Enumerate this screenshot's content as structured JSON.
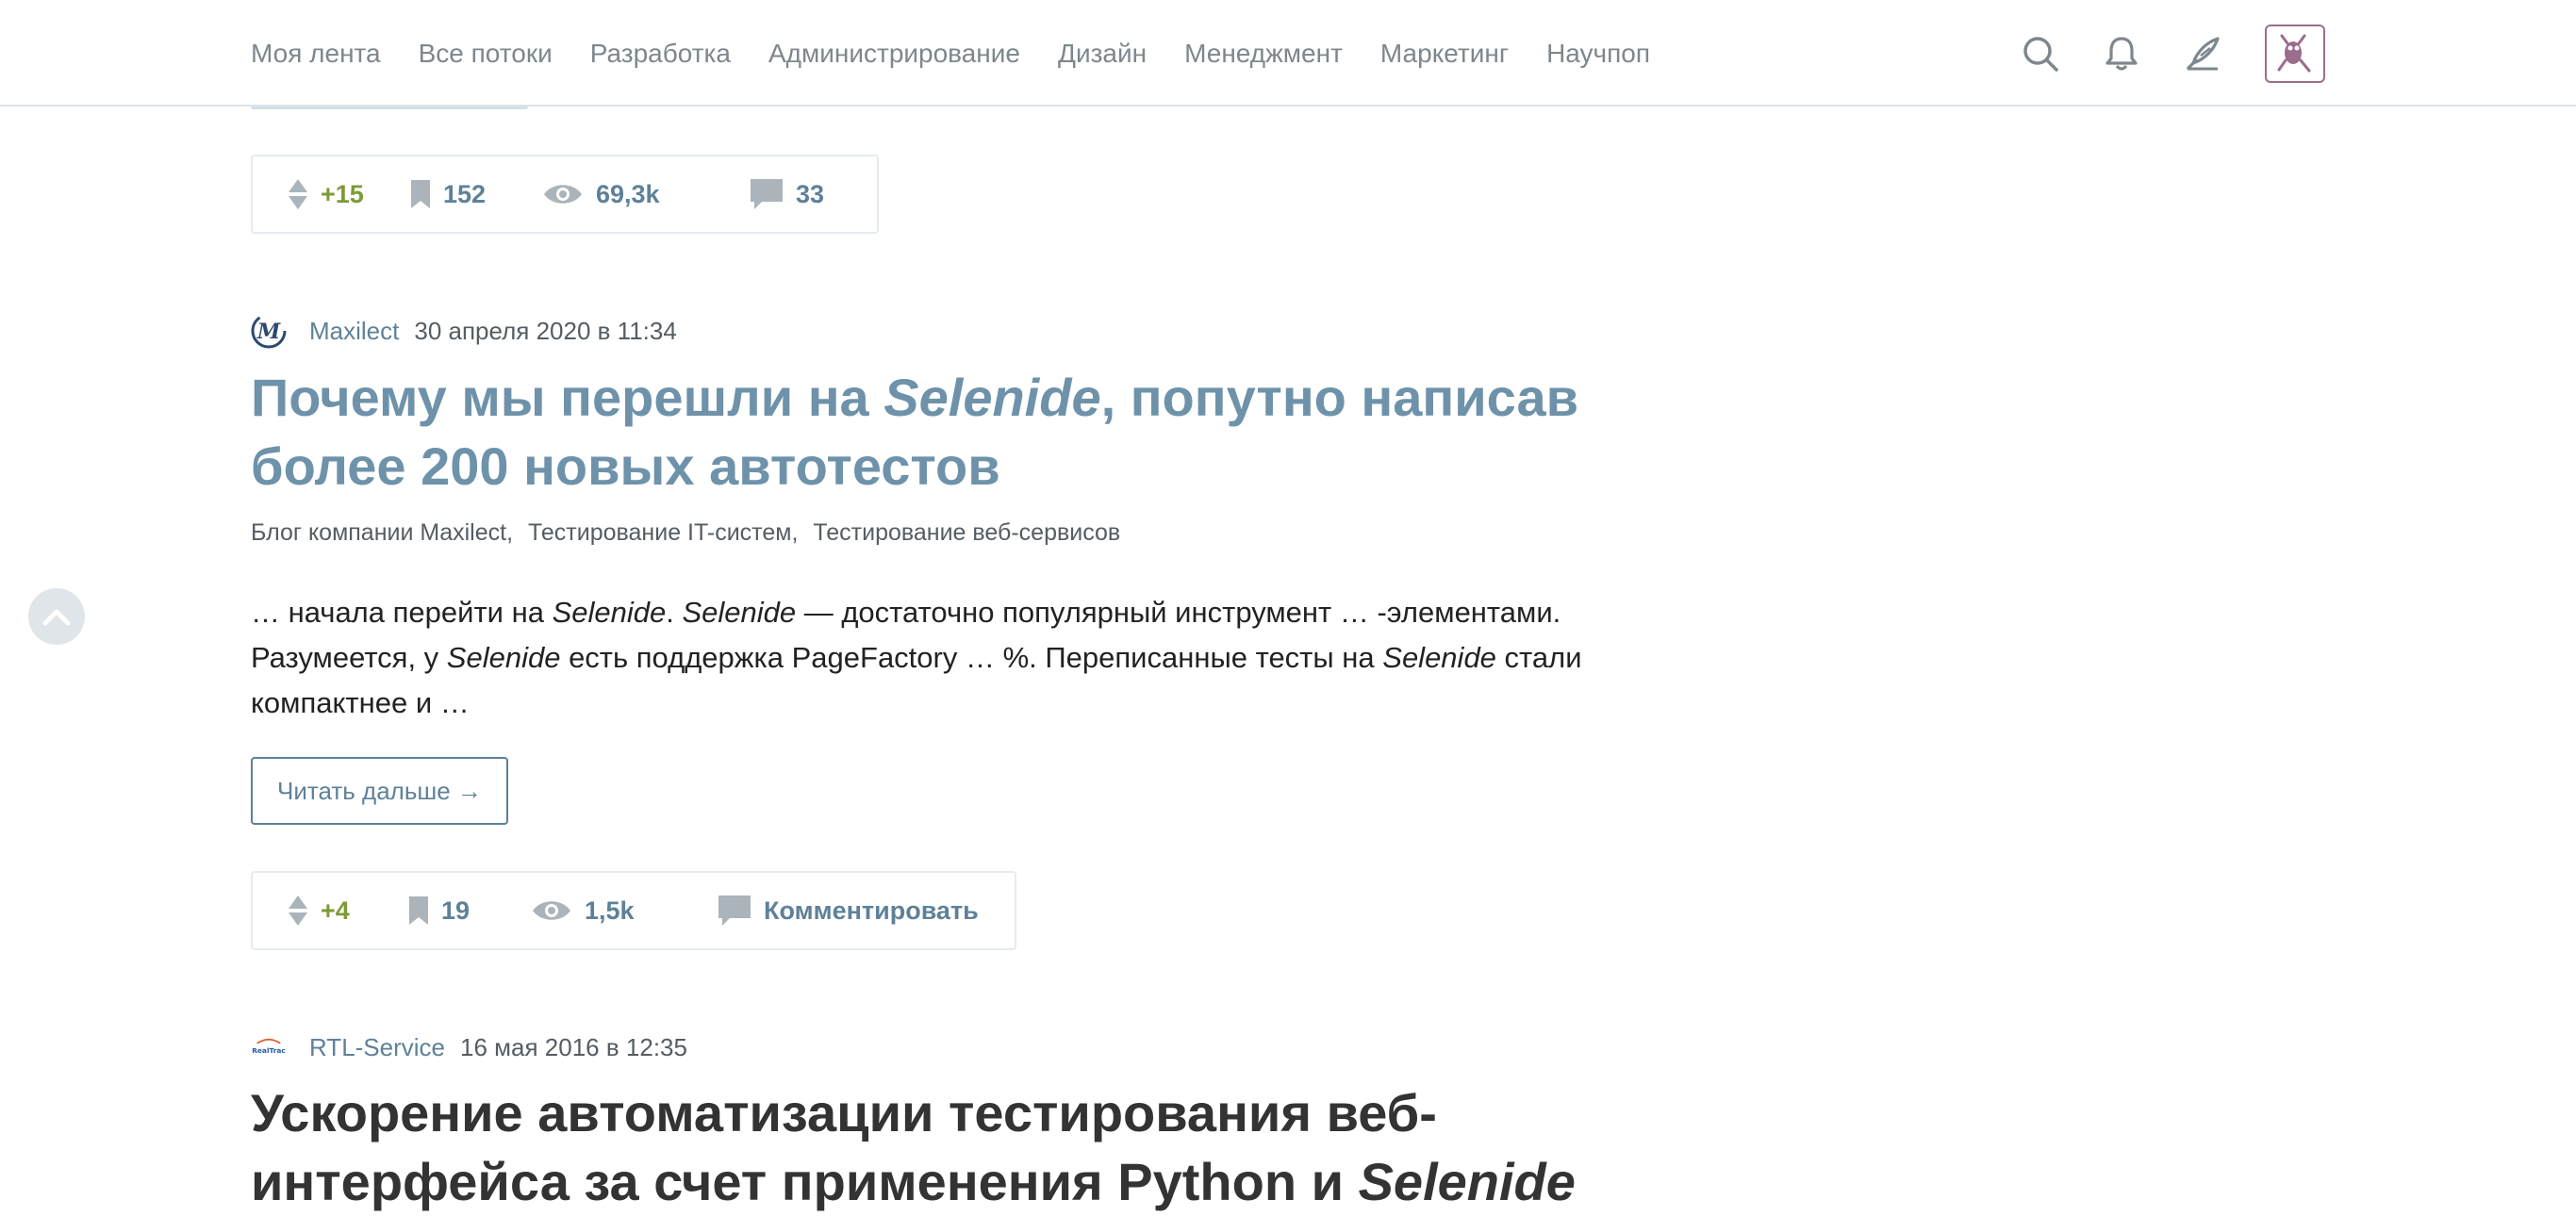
{
  "nav": {
    "items": [
      "Моя лента",
      "Все потоки",
      "Разработка",
      "Администрирование",
      "Дизайн",
      "Менеджмент",
      "Маркетинг",
      "Научпоп"
    ]
  },
  "header_icons": [
    "search-icon",
    "bell-icon",
    "pen-icon",
    "avatar"
  ],
  "colors": {
    "link": "#5e8199",
    "visited_title": "#6e92aa",
    "score": "#7d9a37",
    "avatar_border": "#9b6d8c"
  },
  "prev_article": {
    "stats": {
      "score": "+15",
      "bookmarks": "152",
      "views": "69,3k",
      "comments": "33"
    }
  },
  "articles": [
    {
      "company": "Maxilect",
      "date": "30 апреля 2020 в 11:34",
      "title_part1": "Почему мы перешли на ",
      "title_em": "Selenide",
      "title_part2": ", попутно написав более 200 новых автотестов",
      "hubs": [
        "Блог компании Maxilect,",
        "Тестирование IT-систем,",
        "Тестирование веб-сервисов"
      ],
      "excerpt": {
        "t1": "… начала перейти на ",
        "e1": "Selenide",
        "t2": ". ",
        "e2": "Selenide",
        "t3": " — достаточно популярный инструмент … -элементами. Разумеется, у ",
        "e3": "Selenide",
        "t4": " есть поддержка PageFactory … %. Переписанные тесты на ",
        "e4": "Selenide",
        "t5": " стали компактнее и …"
      },
      "read_more": "Читать дальше →",
      "stats": {
        "score": "+4",
        "bookmarks": "19",
        "views": "1,5k",
        "comments": "Комментировать"
      }
    },
    {
      "company": "RTL-Service",
      "logo_text": "RealTrac",
      "date": "16 мая 2016 в 12:35",
      "title_part1": "Ускорение автоматизации тестирования веб-интерфейса за счет применения Python и ",
      "title_em": "Selenide",
      "title_part2": ""
    }
  ]
}
